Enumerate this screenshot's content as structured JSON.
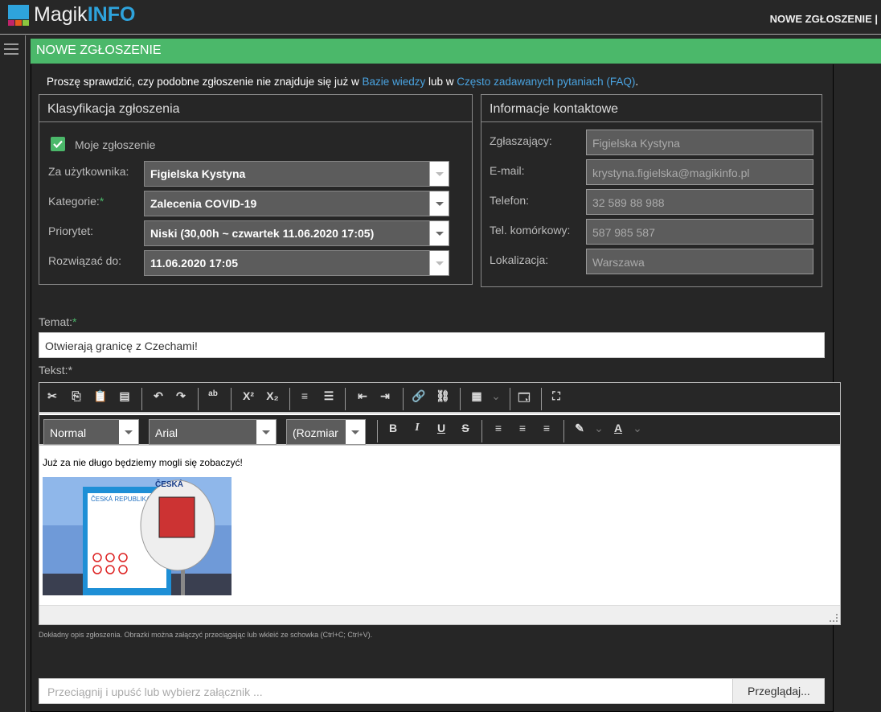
{
  "header": {
    "brand_a": "Magik",
    "brand_b": "INFO",
    "topnav": "NOWE ZGŁOSZENIE"
  },
  "page": {
    "title": "NOWE ZGŁOSZENIE",
    "notice_pre": "Proszę sprawdzić, czy podobne zgłoszenie nie znajduje się już w ",
    "link_kb": "Bazie wiedzy",
    "notice_mid": " lub w ",
    "link_faq": "Często zadawanych pytaniach (FAQ)",
    "notice_end": "."
  },
  "classification": {
    "legend": "Klasyfikacja zgłoszenia",
    "my_ticket": "Moje zgłoszenie",
    "my_ticket_checked": true,
    "fields": [
      {
        "label": "Za użytkownika:",
        "value": "Figielska Kystyna",
        "required": false
      },
      {
        "label": "Kategorie:",
        "value": "Zalecenia COVID-19",
        "required": true
      },
      {
        "label": "Priorytet:",
        "value": "Niski (30,00h ~ czwartek 11.06.2020 17:05)",
        "required": false
      },
      {
        "label": "Rozwiązać do:",
        "value": "11.06.2020 17:05",
        "required": false
      }
    ],
    "required_mark": "*"
  },
  "contact": {
    "legend": "Informacje kontaktowe",
    "fields": [
      {
        "label": "Zgłaszający:",
        "value": "Figielska Kystyna"
      },
      {
        "label": "E-mail:",
        "value": "krystyna.figielska@magikinfo.pl"
      },
      {
        "label": "Telefon:",
        "value": "32 589 88 988"
      },
      {
        "label": "Tel. komórkowy:",
        "value": "587 985 587"
      },
      {
        "label": "Lokalizacja:",
        "value": "Warszawa"
      }
    ]
  },
  "subject": {
    "label": "Temat:",
    "required_mark": "*",
    "value": "Otwierają granicę z Czechami!"
  },
  "text": {
    "label": "Tekst:*",
    "format": "Normal",
    "font": "Arial",
    "size": "(Rozmiar",
    "body": "Już za nie długo będziemy mogli się zobaczyć!",
    "image_text": "ČESKÁ REPUBLIKA",
    "help": "Dokładny opis zgłoszenia. Obrazki można załączyć przeciągając lub wkleić ze schowka (Ctrl+C; Ctrl+V)."
  },
  "attachment": {
    "placeholder": "Przeciągnij i upuść lub wybierz załącznik ...",
    "browse": "Przeglądaj..."
  },
  "colors": {
    "accent_green": "#4bb86a",
    "link": "#4aa3e0",
    "brand_blue": "#2ea3dc"
  }
}
